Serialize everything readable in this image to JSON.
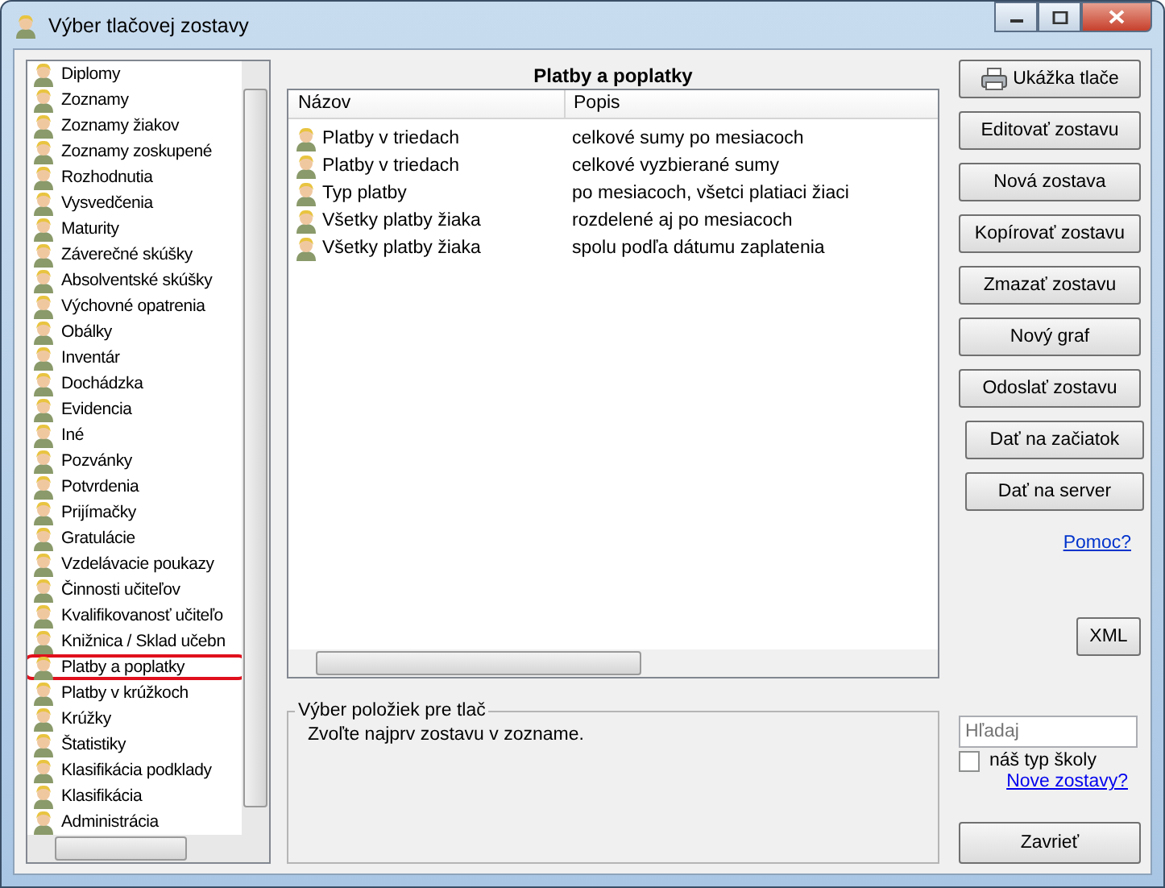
{
  "window": {
    "title": "Výber tlačovej zostavy"
  },
  "categories": [
    {
      "label": "Diplomy",
      "selected": false
    },
    {
      "label": "Zoznamy",
      "selected": false
    },
    {
      "label": "Zoznamy žiakov",
      "selected": false
    },
    {
      "label": "Zoznamy zoskupené",
      "selected": false
    },
    {
      "label": "Rozhodnutia",
      "selected": false
    },
    {
      "label": "Vysvedčenia",
      "selected": false
    },
    {
      "label": "Maturity",
      "selected": false
    },
    {
      "label": "Záverečné skúšky",
      "selected": false
    },
    {
      "label": "Absolventské skúšky",
      "selected": false
    },
    {
      "label": "Výchovné opatrenia",
      "selected": false
    },
    {
      "label": "Obálky",
      "selected": false
    },
    {
      "label": "Inventár",
      "selected": false
    },
    {
      "label": "Dochádzka",
      "selected": false
    },
    {
      "label": "Evidencia",
      "selected": false
    },
    {
      "label": "Iné",
      "selected": false
    },
    {
      "label": "Pozvánky",
      "selected": false
    },
    {
      "label": "Potvrdenia",
      "selected": false
    },
    {
      "label": "Prijímačky",
      "selected": false
    },
    {
      "label": "Gratulácie",
      "selected": false
    },
    {
      "label": "Vzdelávacie poukazy",
      "selected": false
    },
    {
      "label": "Činnosti učiteľov",
      "selected": false
    },
    {
      "label": "Kvalifikovanosť učiteľo",
      "selected": false
    },
    {
      "label": "Knižnica / Sklad učebn",
      "selected": false
    },
    {
      "label": "Platby a poplatky",
      "selected": true
    },
    {
      "label": "Platby v krúžkoch",
      "selected": false
    },
    {
      "label": "Krúžky",
      "selected": false
    },
    {
      "label": "Štatistiky",
      "selected": false
    },
    {
      "label": "Klasifikácia podklady",
      "selected": false
    },
    {
      "label": "Klasifikácia",
      "selected": false
    },
    {
      "label": "Administrácia",
      "selected": false
    }
  ],
  "reports": {
    "title": "Platby a poplatky",
    "columns": [
      "Názov",
      "Popis"
    ],
    "rows": [
      {
        "name": "Platby v triedach",
        "description": "celkové sumy po mesiacoch"
      },
      {
        "name": "Platby v triedach",
        "description": "celkové vyzbierané sumy"
      },
      {
        "name": "Typ platby",
        "description": "po mesiacoch, všetci platiaci žiaci"
      },
      {
        "name": "Všetky platby žiaka",
        "description": "rozdelené aj po mesiacoch"
      },
      {
        "name": "Všetky platby žiaka",
        "description": "spolu podľa dátumu zaplatenia"
      }
    ]
  },
  "selection_group": {
    "title": "Výber položiek pre tlač",
    "message": "Zvoľte najprv zostavu v zozname."
  },
  "buttons": [
    "Ukážka tlače",
    "Editovať zostavu",
    "Nová zostava",
    "Kopírovať zostavu",
    "Zmazať zostavu",
    "Nový graf",
    "Odoslať zostavu",
    "Dať na začiatok",
    "Dať na server"
  ],
  "help_link": "Pomoc?",
  "xml_button": "XML",
  "search": {
    "placeholder": "Hľadaj"
  },
  "school_type_checkbox": {
    "label": "náš typ školy",
    "checked": false
  },
  "new_reports_link": "Nove zostavy?",
  "close_button": "Zavrieť"
}
